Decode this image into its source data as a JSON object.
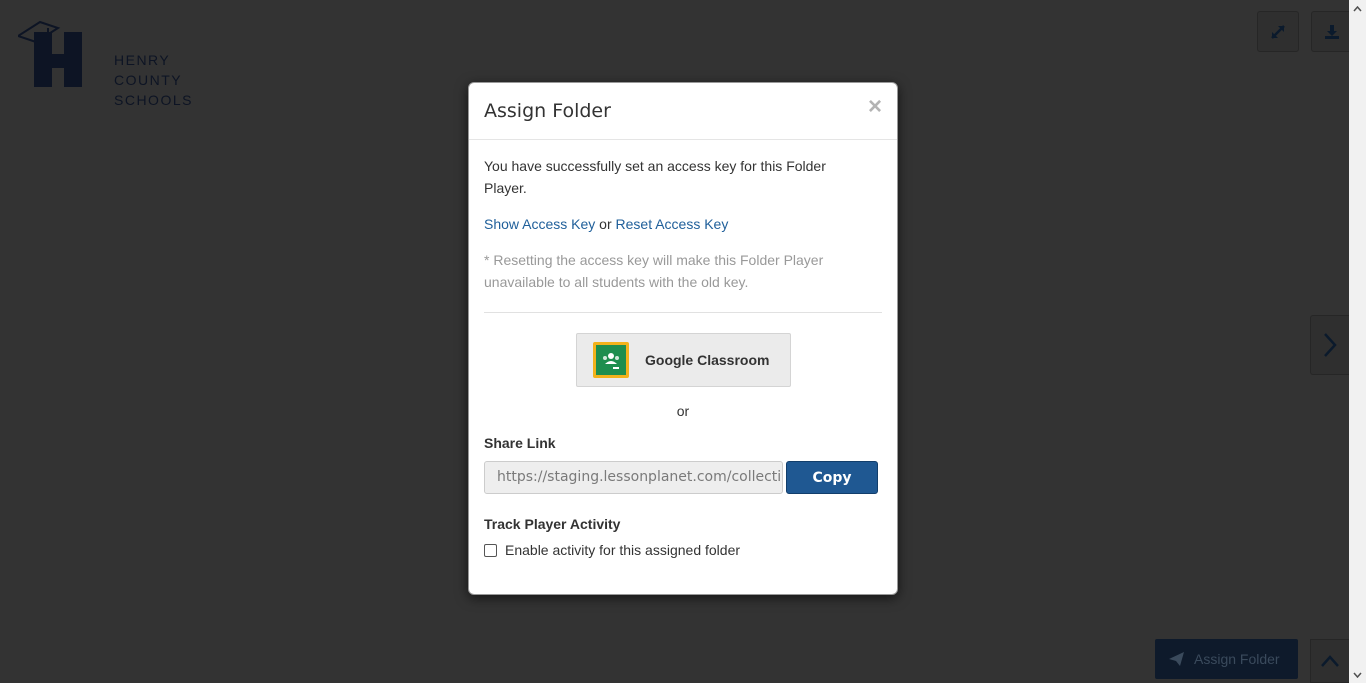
{
  "background": {
    "logo": {
      "lines": [
        "HENRY",
        "COUNTY",
        "SCHOOLS"
      ]
    },
    "assign_button_label": "Assign Folder"
  },
  "modal": {
    "title": "Assign Folder",
    "close_symbol": "×",
    "success_message": "You have successfully set an access key for this Folder Player.",
    "show_key_link": "Show Access Key",
    "or_word": "or",
    "reset_key_link": "Reset Access Key",
    "warning": "* Resetting the access key will make this Folder Player unavailable to all students with the old key.",
    "google_classroom_label": "Google Classroom",
    "or_separator": "or",
    "share_link_label": "Share Link",
    "share_link_value": "https://staging.lessonplanet.com/collectio",
    "copy_label": "Copy",
    "track_activity_label": "Track Player Activity",
    "enable_activity_label": "Enable activity for this assigned folder",
    "enable_activity_checked": false
  },
  "icons": {
    "expand": "expand-icon",
    "download": "download-icon",
    "next": "chevron-right-icon",
    "scroll_top": "chevron-up-icon",
    "send": "paper-plane-icon",
    "google_classroom": "google-classroom-icon"
  },
  "colors": {
    "overlay": "#333333",
    "link": "#1f5f9a",
    "primary_button": "#1f5892",
    "google_classroom_green": "#1e8e4e",
    "google_classroom_frame": "#f2b21c"
  }
}
